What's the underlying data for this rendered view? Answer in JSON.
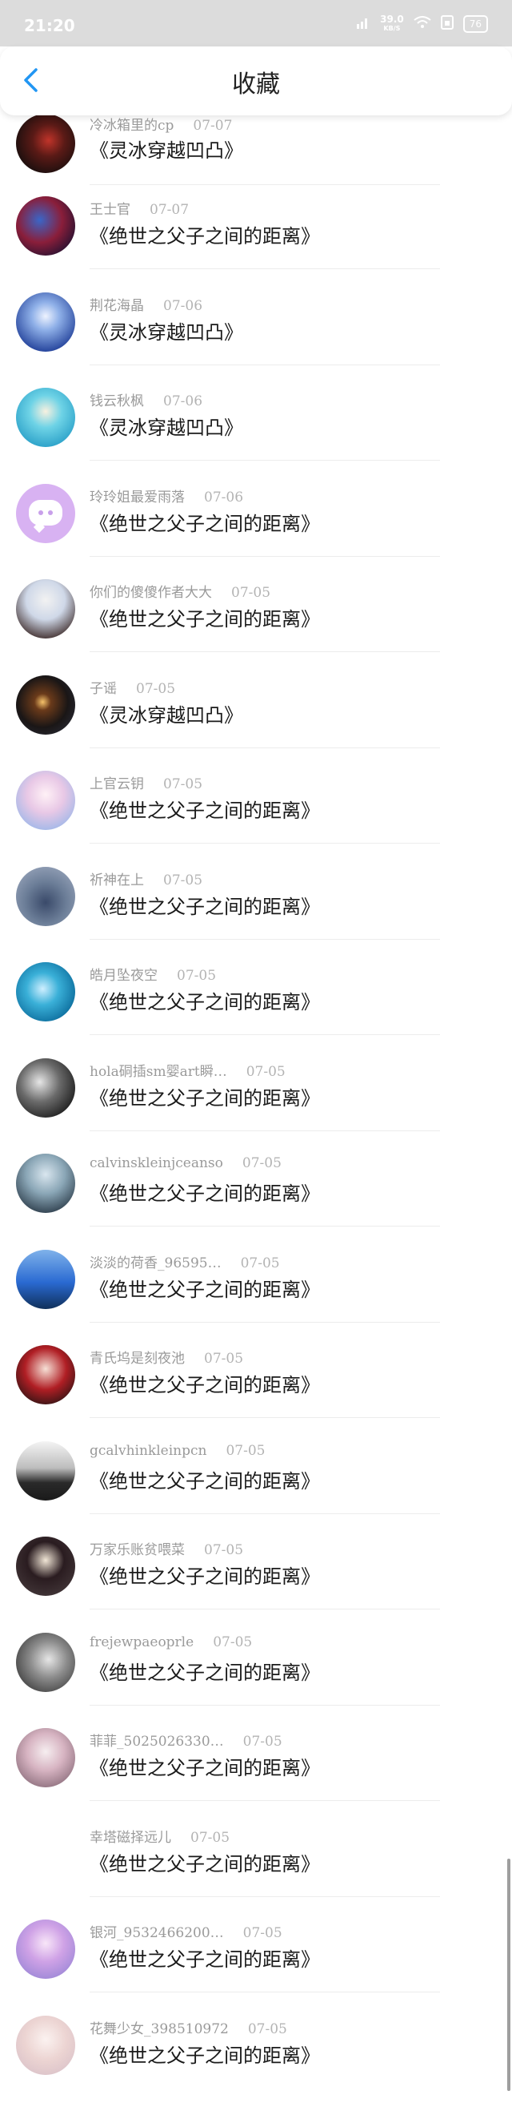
{
  "status_bar": {
    "time": "21:20",
    "speed_value": "39.0",
    "speed_unit": "KB/S",
    "battery": "76"
  },
  "header": {
    "title": "收藏"
  },
  "favorites": [
    {
      "user": "冷冰箱里的cp",
      "date": "07-07",
      "title": "《灵冰穿越凹凸》"
    },
    {
      "user": "王士官",
      "date": "07-07",
      "title": "《绝世之父子之间的距离》"
    },
    {
      "user": "荆花海晶",
      "date": "07-06",
      "title": "《灵冰穿越凹凸》"
    },
    {
      "user": "钱云秋枫",
      "date": "07-06",
      "title": "《灵冰穿越凹凸》"
    },
    {
      "user": "玲玲姐最爱雨落",
      "date": "07-06",
      "title": "《绝世之父子之间的距离》"
    },
    {
      "user": "你们的傻傻作者大大",
      "date": "07-05",
      "title": "《绝世之父子之间的距离》"
    },
    {
      "user": "子谣",
      "date": "07-05",
      "title": "《灵冰穿越凹凸》"
    },
    {
      "user": "上官云钥",
      "date": "07-05",
      "title": "《绝世之父子之间的距离》"
    },
    {
      "user": "祈神在上",
      "date": "07-05",
      "title": "《绝世之父子之间的距离》"
    },
    {
      "user": "皓月坠夜空",
      "date": "07-05",
      "title": "《绝世之父子之间的距离》"
    },
    {
      "user": "hola硐插sm婴art瞬…",
      "date": "07-05",
      "title": "《绝世之父子之间的距离》"
    },
    {
      "user": "calvinskleinjceanso",
      "date": "07-05",
      "title": "《绝世之父子之间的距离》"
    },
    {
      "user": "淡淡的荷香_96595…",
      "date": "07-05",
      "title": "《绝世之父子之间的距离》"
    },
    {
      "user": "青氏坞是刻夜池",
      "date": "07-05",
      "title": "《绝世之父子之间的距离》"
    },
    {
      "user": "gcalvhinkleinpcn",
      "date": "07-05",
      "title": "《绝世之父子之间的距离》"
    },
    {
      "user": "万家乐账贫喂菜",
      "date": "07-05",
      "title": "《绝世之父子之间的距离》"
    },
    {
      "user": "frejewpaeoprle",
      "date": "07-05",
      "title": "《绝世之父子之间的距离》"
    },
    {
      "user": "菲菲_5025026330…",
      "date": "07-05",
      "title": "《绝世之父子之间的距离》"
    },
    {
      "user": "幸塔磁择远儿",
      "date": "07-05",
      "title": "《绝世之父子之间的距离》"
    },
    {
      "user": "银河_9532466200…",
      "date": "07-05",
      "title": "《绝世之父子之间的距离》"
    },
    {
      "user": "花舞少女_398510972",
      "date": "07-05",
      "title": "《绝世之父子之间的距离》"
    }
  ],
  "colors": {
    "status_bar_bg": "#dcdcdc",
    "accent": "#2196f3",
    "title_text": "#1a1a1a",
    "meta_text": "#9a9a9a"
  },
  "icons": {
    "back": "chevron-left-icon",
    "signal": "signal-icon",
    "wifi": "wifi-icon",
    "sim": "sim-icon"
  }
}
